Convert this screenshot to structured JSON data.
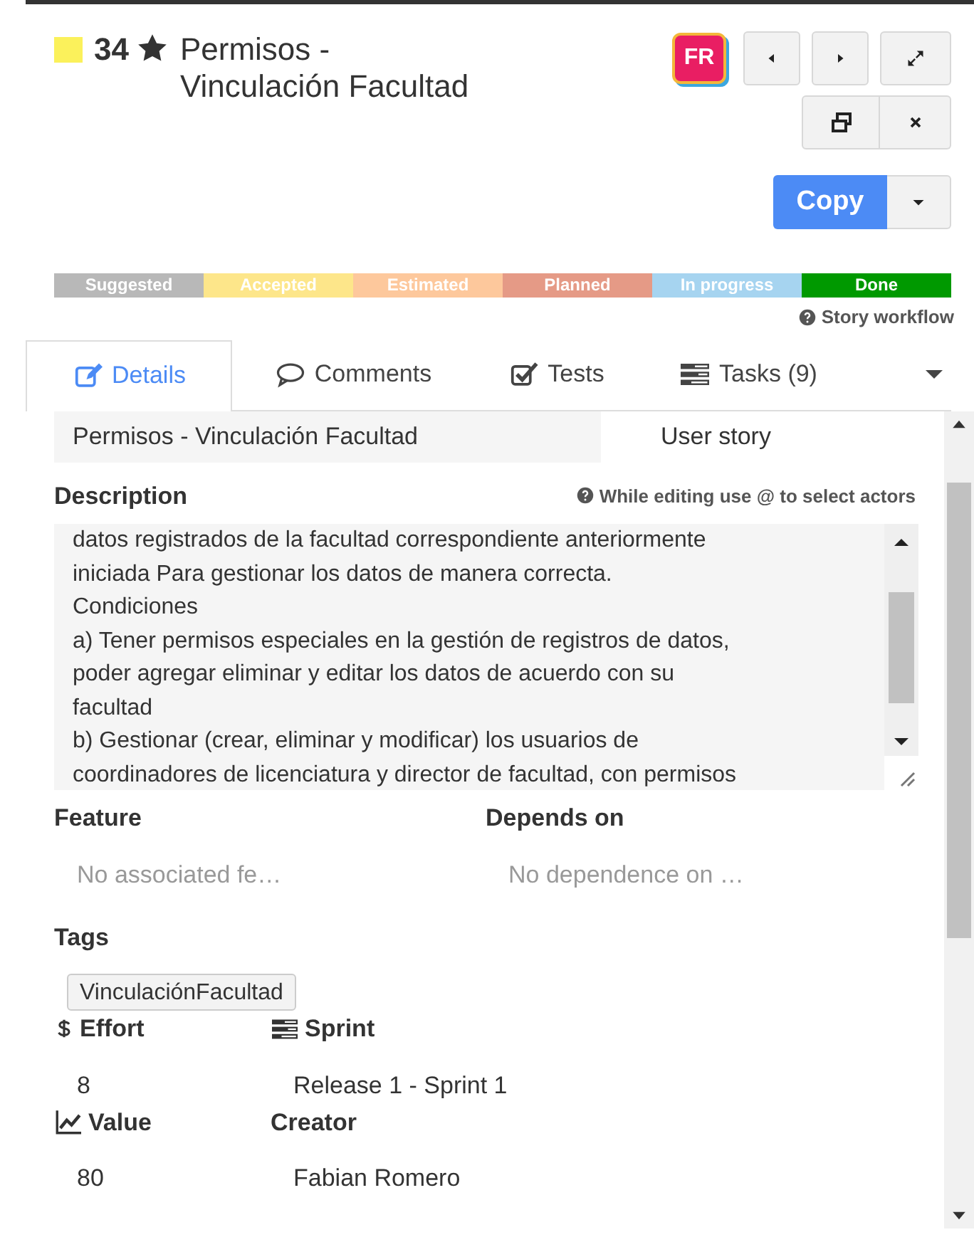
{
  "header": {
    "number": "34",
    "starred": true,
    "title": "Permisos - Vinculación Facultad",
    "avatar": {
      "initials": "FR",
      "color": "#e91e63"
    }
  },
  "copy_button": "Copy",
  "workflow": [
    {
      "label": "Suggested",
      "color": "#b8b8b8"
    },
    {
      "label": "Accepted",
      "color": "#fde68a"
    },
    {
      "label": "Estimated",
      "color": "#fdc89c"
    },
    {
      "label": "Planned",
      "color": "#e59a86"
    },
    {
      "label": "In progress",
      "color": "#a6d4f0"
    },
    {
      "label": "Done",
      "color": "#009900"
    }
  ],
  "workflow_link": "Story workflow",
  "tabs": [
    {
      "label": "Details",
      "selected": true
    },
    {
      "label": "Comments",
      "selected": false
    },
    {
      "label": "Tests",
      "selected": false
    },
    {
      "label": "Tasks (9)",
      "selected": false
    }
  ],
  "name_field": "Permisos - Vinculación Facultad",
  "type_field": "User story",
  "description": {
    "label": "Description",
    "hint": "While editing use @ to select actors",
    "lines": [
      "datos registrados de la facultad correspondiente anteriormente",
      "iniciada Para gestionar los datos de manera correcta.",
      "Condiciones",
      "a) Tener permisos especiales en la gestión de registros de datos,",
      "poder agregar eliminar y editar los datos de acuerdo con su",
      "facultad",
      "b) Gestionar (crear, eliminar y modificar) los usuarios de",
      "coordinadores de licenciatura y director de facultad, con permisos"
    ]
  },
  "feature": {
    "label": "Feature",
    "placeholder": "No associated fe…"
  },
  "depends_on": {
    "label": "Depends on",
    "placeholder": "No dependence on …"
  },
  "tags": {
    "label": "Tags",
    "items": [
      "VinculaciónFacultad"
    ]
  },
  "effort": {
    "label": "Effort",
    "value": "8"
  },
  "sprint": {
    "label": "Sprint",
    "value": "Release 1 - Sprint 1"
  },
  "value": {
    "label": "Value",
    "value": "80"
  },
  "creator": {
    "label": "Creator",
    "value": "Fabian Romero"
  }
}
